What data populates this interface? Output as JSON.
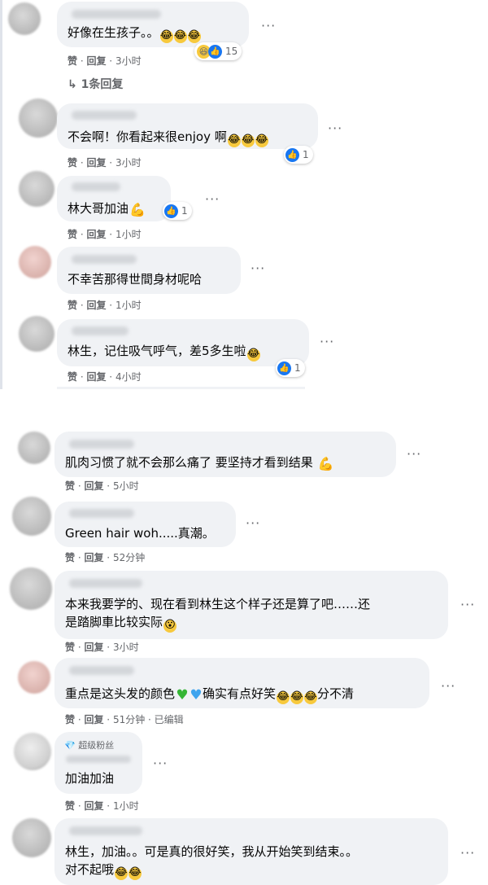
{
  "actions": {
    "like": "赞",
    "reply": "回复",
    "separator": "·",
    "edited": "已编辑"
  },
  "more": "···",
  "panel1": {
    "c1": {
      "text": "好像在生孩子。。",
      "time": "3小时",
      "react_count": "15",
      "replies": "1条回复"
    },
    "c2": {
      "text": "不会啊！你看起来很enjoy 啊",
      "time": "3小时",
      "react_count": "1"
    },
    "c3": {
      "text": "林大哥加油",
      "time": "1小时",
      "react_count": "1"
    },
    "c4": {
      "text": "不幸苦那得世間身材呢哈",
      "time": "1小时"
    },
    "c5": {
      "text": "林生，记住吸气呼气，差5多生啦",
      "time": "4小时",
      "react_count": "1"
    }
  },
  "panel2": {
    "c1": {
      "text": "肌肉习惯了就不会那么痛了 要坚持才看到结果",
      "time": "5小时"
    },
    "c2": {
      "text": "Green hair woh.....真潮。",
      "time": "52分钟"
    },
    "c3": {
      "line1": "本来我要学的、现在看到林生这个样子还是算了吧……还",
      "line2": "是踏脚車比较实际",
      "time": "3小时"
    },
    "c4": {
      "text_a": "重点是这头发的颜色",
      "text_b": "确实有点好笑",
      "text_c": "分不清",
      "time": "51分钟"
    },
    "c5": {
      "badge": "超级粉丝",
      "text": "加油加油",
      "time": "1小时"
    },
    "c6": {
      "line1": "林生，加油。。可是真的很好笑，我从开始笑到结束。。",
      "line2": "对不起哦"
    }
  },
  "icons": {
    "haha": "laughing-emoji",
    "like": "like-thumb",
    "heart_green": "green-heart",
    "heart_blue": "blue-heart",
    "strong": "flexed-biceps",
    "wink": "smiling-emoji",
    "reply_arrow": "reply-arrow",
    "diamond": "diamond-badge"
  },
  "colors": {
    "bubble": "#f0f2f5",
    "meta": "#65676b",
    "like_blue": "#1877f2",
    "emoji_yellow": "#f7c93d"
  }
}
